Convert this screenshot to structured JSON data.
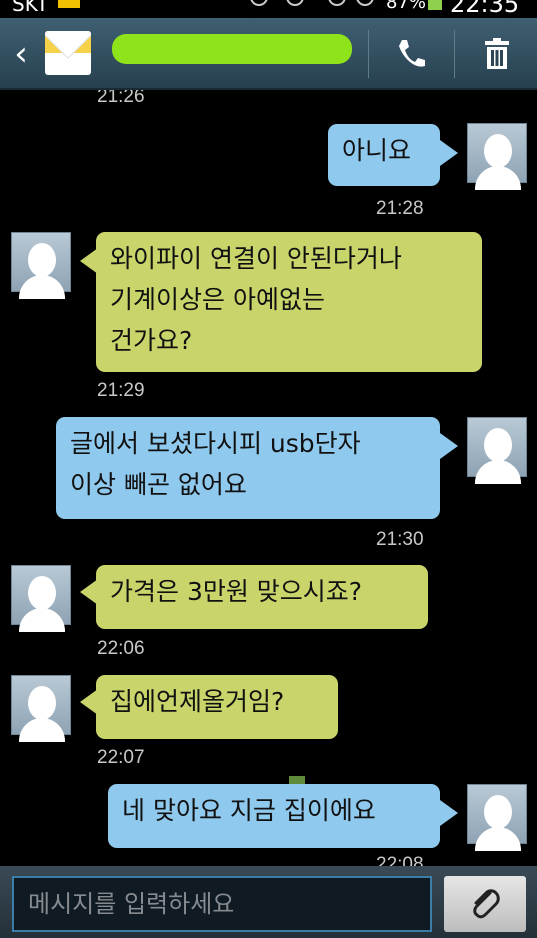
{
  "status_bar": {
    "carrier": "SKT",
    "battery": "87%",
    "time": "22:35"
  },
  "header": {
    "contact_name": ""
  },
  "messages": [
    {
      "time": "21:26"
    },
    {
      "text": "아니요",
      "direction": "outgoing"
    },
    {
      "time": "21:28"
    },
    {
      "lines": [
        "와이파이 연결이 안된다거나",
        "기계이상은 아예없는",
        "건가요?"
      ],
      "direction": "incoming"
    },
    {
      "time": "21:29"
    },
    {
      "lines": [
        "글에서 보셨다시피 usb단자",
        "이상 빼곤 없어요"
      ],
      "direction": "outgoing"
    },
    {
      "time": "21:30"
    },
    {
      "text": "가격은 3만원 맞으시죠?",
      "direction": "incoming"
    },
    {
      "time": "22:06"
    },
    {
      "text": "집에언제올거임?",
      "direction": "incoming"
    },
    {
      "time": "22:07"
    },
    {
      "text": "네 맞아요 지금 집이에요",
      "direction": "outgoing"
    },
    {
      "time": "22:08"
    }
  ],
  "composer": {
    "placeholder": "메시지를 입력하세요"
  },
  "colors": {
    "outgoing_bubble": "#8fc9ee",
    "incoming_bubble": "#c9d56a",
    "header": "#3f6072",
    "name_highlight": "#8fe31b"
  },
  "icons": {
    "back": "chevron-left-icon",
    "contact": "envelope-icon",
    "call": "phone-icon",
    "delete": "trash-icon",
    "attach": "paperclip-icon"
  }
}
